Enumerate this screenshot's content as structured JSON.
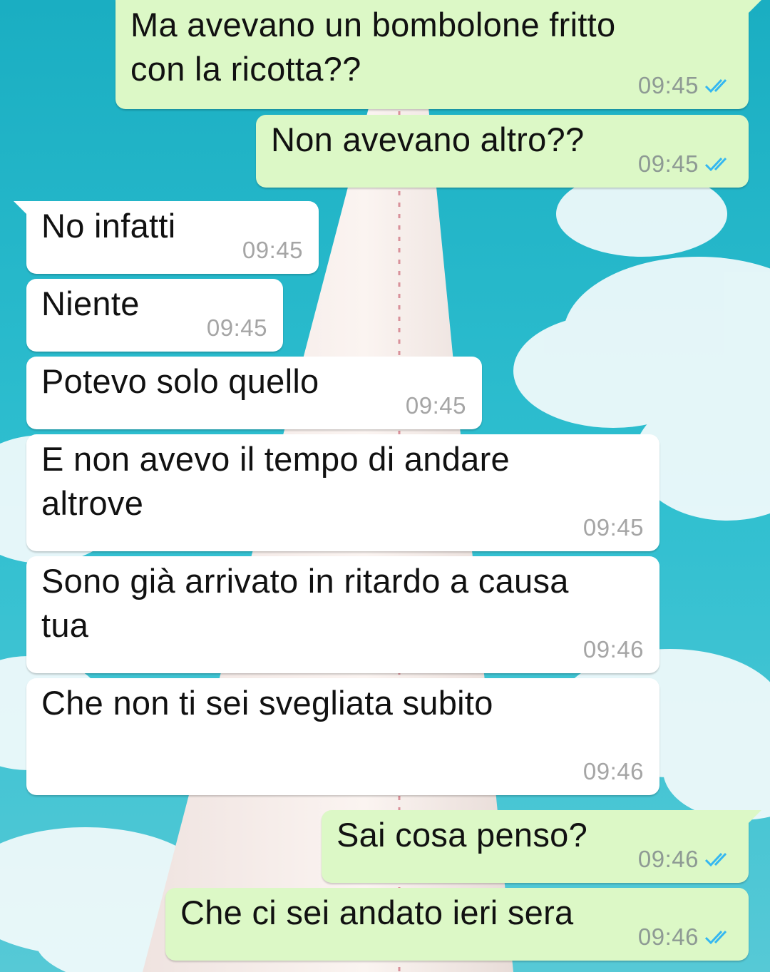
{
  "colors": {
    "outgoing_bubble": "#dcf8c6",
    "incoming_bubble": "#ffffff",
    "read_ticks": "#34b7f1",
    "sky": "#2bb8c9"
  },
  "messages": [
    {
      "direction": "outgoing",
      "text": "Ma avevano un bombolone fritto\ncon la ricotta??",
      "time": "09:45",
      "status_icon": "double-check-read-icon"
    },
    {
      "direction": "outgoing",
      "text": "Non avevano altro??",
      "time": "09:45",
      "status_icon": "double-check-read-icon"
    },
    {
      "direction": "incoming",
      "text": "No infatti",
      "time": "09:45"
    },
    {
      "direction": "incoming",
      "text": "Niente",
      "time": "09:45"
    },
    {
      "direction": "incoming",
      "text": "Potevo solo quello",
      "time": "09:45"
    },
    {
      "direction": "incoming",
      "text": "E non avevo il tempo di andare\naltrove",
      "time": "09:45"
    },
    {
      "direction": "incoming",
      "text": "Sono già arrivato in ritardo a causa\ntua",
      "time": "09:46"
    },
    {
      "direction": "incoming",
      "text": "Che non ti sei svegliata subito",
      "time": "09:46"
    },
    {
      "direction": "outgoing",
      "text": "Sai cosa penso?",
      "time": "09:46",
      "status_icon": "double-check-read-icon"
    },
    {
      "direction": "outgoing",
      "text": "Che ci sei andato ieri sera",
      "time": "09:46",
      "status_icon": "double-check-read-icon"
    }
  ]
}
